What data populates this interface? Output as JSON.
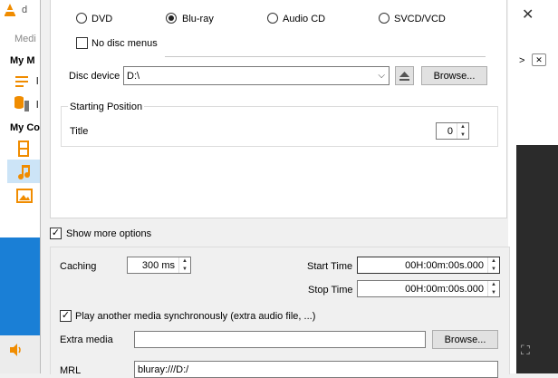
{
  "background_window": {
    "title_fragment": "d",
    "menu_fragment": "Medi",
    "section_my_media": "My M",
    "section_my_computer": "My Co",
    "item_letter_1": "l",
    "item_letter_2": "l",
    "right_fragment": ">"
  },
  "disc": {
    "types": [
      {
        "label": "DVD",
        "selected": false
      },
      {
        "label": "Blu-ray",
        "selected": true
      },
      {
        "label": "Audio CD",
        "selected": false
      },
      {
        "label": "SVCD/VCD",
        "selected": false
      }
    ],
    "no_disc_menus_label": "No disc menus",
    "no_disc_menus_checked": false,
    "device_label": "Disc device",
    "device_value": "D:\\",
    "browse_label": "Browse..."
  },
  "starting_position": {
    "group_title": "Starting Position",
    "title_label": "Title",
    "title_value": "0"
  },
  "more_options": {
    "show_label": "Show more options",
    "show_checked": true,
    "caching_label": "Caching",
    "caching_value": "300 ms",
    "start_time_label": "Start Time",
    "start_time_value": "00H:00m:00s.000",
    "stop_time_label": "Stop Time",
    "stop_time_value": "00H:00m:00s.000",
    "play_sync_label": "Play another media synchronously (extra audio file, ...)",
    "play_sync_checked": true,
    "extra_media_label": "Extra media",
    "extra_media_value": "",
    "browse_label": "Browse...",
    "mrl_label": "MRL",
    "mrl_value": "bluray:///D:/"
  },
  "colors": {
    "accent": "#1a7fd6",
    "vlc_orange": "#f08c00"
  }
}
